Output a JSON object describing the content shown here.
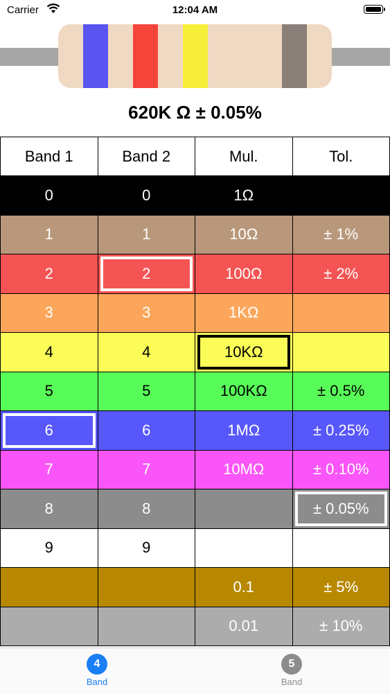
{
  "status_bar": {
    "carrier": "Carrier",
    "time": "12:04 AM"
  },
  "resistor": {
    "body_color": "#efd9c2",
    "bands": [
      {
        "color": "#5a55f0"
      },
      {
        "color": "#f5443a"
      },
      {
        "color": "#f7ee3a"
      },
      {
        "color": "#8a7f79"
      }
    ]
  },
  "value_text": "620K Ω ± 0.05%",
  "table": {
    "headers": [
      "Band 1",
      "Band 2",
      "Mul.",
      "Tol."
    ],
    "rows": [
      {
        "bg": "#000000",
        "fg": "#ffffff",
        "cells": [
          "0",
          "0",
          "1Ω",
          ""
        ]
      },
      {
        "bg": "#b8977b",
        "fg": "#ffffff",
        "cells": [
          "1",
          "1",
          "10Ω",
          "± 1%"
        ]
      },
      {
        "bg": "#f55454",
        "fg": "#ffffff",
        "cells": [
          "2",
          "2",
          "100Ω",
          "± 2%"
        ]
      },
      {
        "bg": "#fba65a",
        "fg": "#ffffff",
        "cells": [
          "3",
          "3",
          "1KΩ",
          ""
        ]
      },
      {
        "bg": "#fcfc58",
        "fg": "#000000",
        "cells": [
          "4",
          "4",
          "10KΩ",
          ""
        ]
      },
      {
        "bg": "#58fc58",
        "fg": "#000000",
        "cells": [
          "5",
          "5",
          "100KΩ",
          "± 0.5%"
        ]
      },
      {
        "bg": "#5757fc",
        "fg": "#ffffff",
        "cells": [
          "6",
          "6",
          "1MΩ",
          "± 0.25%"
        ]
      },
      {
        "bg": "#fa55f9",
        "fg": "#ffffff",
        "cells": [
          "7",
          "7",
          "10MΩ",
          "± 0.10%"
        ]
      },
      {
        "bg": "#8c8c8c",
        "fg": "#ffffff",
        "cells": [
          "8",
          "8",
          "",
          "± 0.05%"
        ]
      },
      {
        "bg": "#ffffff",
        "fg": "#000000",
        "cells": [
          "9",
          "9",
          "",
          ""
        ]
      },
      {
        "bg": "#b78800",
        "fg": "#ffffff",
        "cells": [
          "",
          "",
          "0.1",
          "± 5%"
        ]
      },
      {
        "bg": "#acacac",
        "fg": "#ffffff",
        "cells": [
          "",
          "",
          "0.01",
          "± 10%"
        ]
      }
    ],
    "selected": {
      "band1": "6",
      "band2": "2",
      "multiplier": "10KΩ",
      "tolerance": "± 0.05%"
    }
  },
  "tabs": [
    {
      "number": "4",
      "label": "Band",
      "color": "#1a7ef5",
      "active": true
    },
    {
      "number": "5",
      "label": "Band",
      "color": "#8c8c8c",
      "active": false
    }
  ]
}
